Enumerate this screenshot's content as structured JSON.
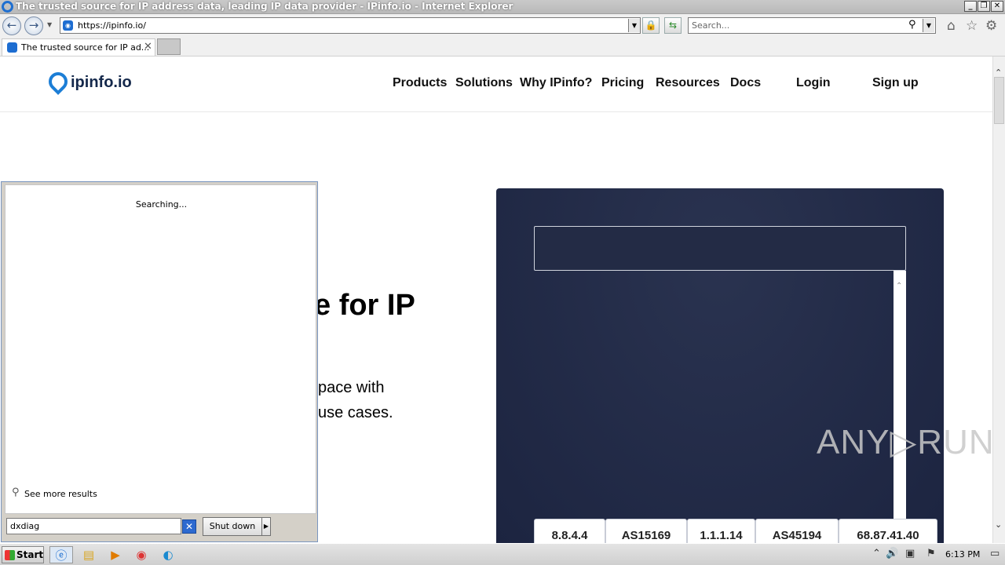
{
  "window": {
    "title": "The trusted source for IP address data, leading IP data provider - IPinfo.io - Internet Explorer",
    "min": "_",
    "max": "❐",
    "close": "✕"
  },
  "navbar": {
    "back": "←",
    "forward": "→",
    "url": "https://ipinfo.io/",
    "dropdown": "▼",
    "search_placeholder": "Search..."
  },
  "tab": {
    "label": "The trusted source for IP ad...",
    "close": "✕"
  },
  "site": {
    "logo": "ipinfo.io",
    "nav": [
      "Products",
      "Solutions",
      "Why IPinfo?",
      "Pricing",
      "Resources",
      "Docs"
    ],
    "login": "Login",
    "signup": "Sign up",
    "hero_line1": "e for IP",
    "hero_line2": "pace with",
    "hero_line3": "use cases.",
    "chips": [
      "8.8.4.4",
      "AS15169",
      "1.1.1.14",
      "AS45194",
      "68.87.41.40"
    ]
  },
  "watermark": "ANY▷RUN",
  "startmenu": {
    "status": "Searching...",
    "see_more": "See more results",
    "query": "dxdiag",
    "shutdown": "Shut down"
  },
  "taskbar": {
    "start": "Start",
    "clock": "6:13 PM"
  }
}
